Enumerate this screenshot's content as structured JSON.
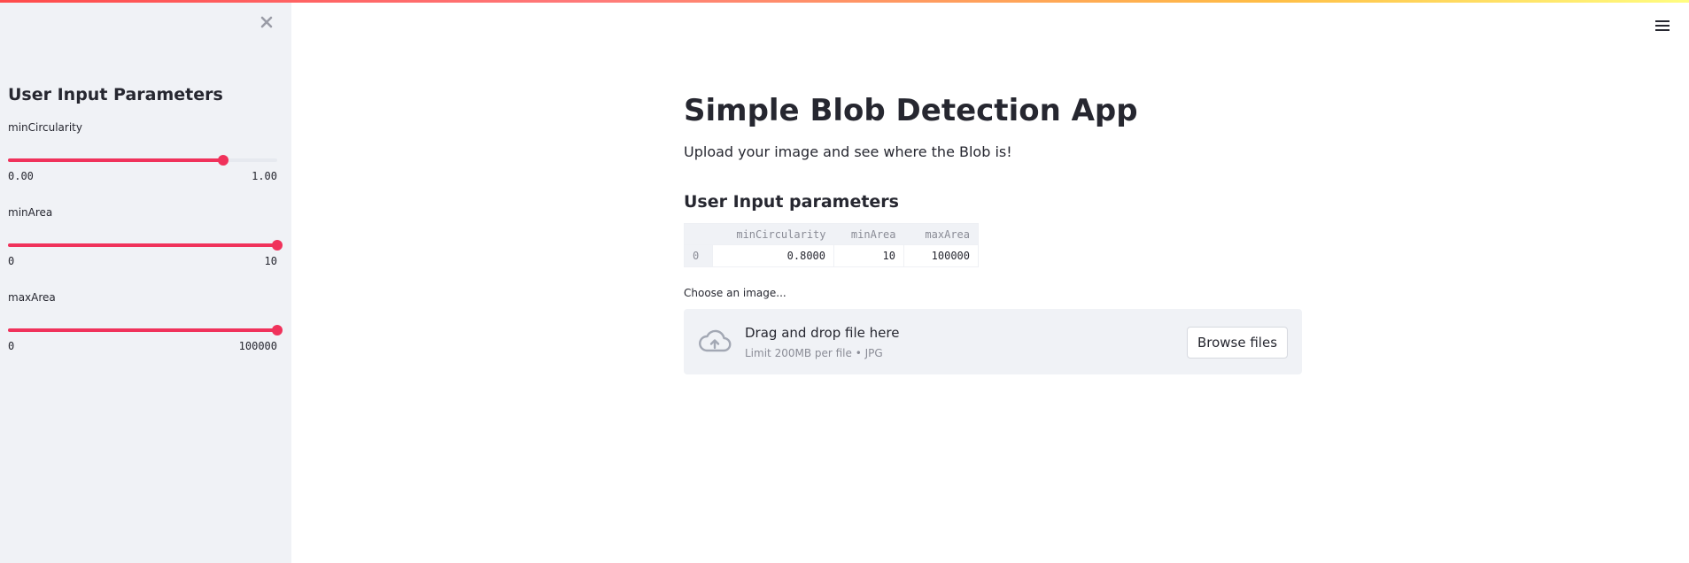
{
  "sidebar": {
    "title": "User Input Parameters",
    "close_icon": "close-icon",
    "sliders": [
      {
        "label": "minCircularity",
        "min_label": "0.00",
        "max_label": "1.00",
        "value_fraction": 0.8
      },
      {
        "label": "minArea",
        "min_label": "0",
        "max_label": "10",
        "value_fraction": 1.0
      },
      {
        "label": "maxArea",
        "min_label": "0",
        "max_label": "100000",
        "value_fraction": 1.0
      }
    ]
  },
  "header": {
    "menu_icon": "hamburger-menu-icon"
  },
  "main": {
    "title": "Simple Blob Detection App",
    "subtitle": "Upload your image and see where the Blob is!",
    "params_heading": "User Input parameters",
    "table": {
      "columns": [
        "minCircularity",
        "minArea",
        "maxArea"
      ],
      "rows": [
        {
          "index": "0",
          "cells": [
            "0.8000",
            "10",
            "100000"
          ]
        }
      ]
    },
    "uploader": {
      "label": "Choose an image...",
      "drop_text": "Drag and drop file here",
      "limit_text": "Limit 200MB per file • JPG",
      "browse_label": "Browse files",
      "icon": "cloud-upload-icon"
    }
  },
  "colors": {
    "accent": "#f0325b",
    "sidebar_bg": "#f0f2f6",
    "text": "#262730"
  }
}
